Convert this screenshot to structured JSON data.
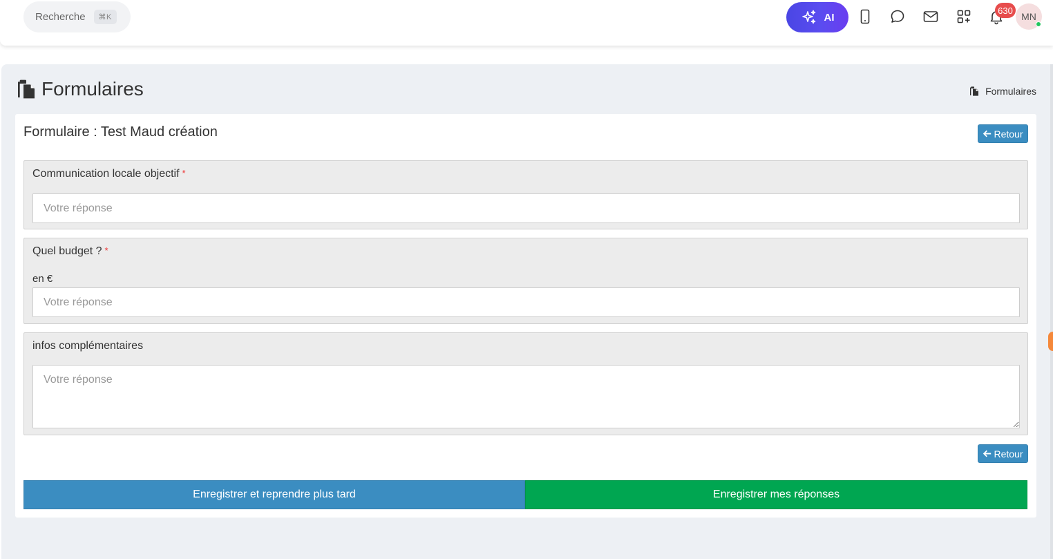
{
  "topbar": {
    "search_label": "Recherche",
    "search_shortcut": "⌘K",
    "ai_label": "AI",
    "notification_count": "630",
    "avatar_initials": "MN",
    "accent_gradient": [
      "#4a46e4",
      "#6a3df0"
    ]
  },
  "page": {
    "title": "Formulaires",
    "breadcrumb": "Formulaires"
  },
  "form": {
    "title": "Formulaire : Test Maud création",
    "back_label": "Retour",
    "questions": [
      {
        "label": "Communication locale objectif",
        "required": "*",
        "placeholder": "Votre réponse"
      },
      {
        "label": "Quel budget ?",
        "required": "*",
        "help": "en €",
        "placeholder": "Votre réponse"
      },
      {
        "label": "infos complémentaires",
        "placeholder": "Votre réponse"
      }
    ],
    "save_later_label": "Enregistrer et reprendre plus tard",
    "submit_label": "Enregistrer mes réponses"
  },
  "colors": {
    "primary": "#3b8dc1",
    "success": "#00a651",
    "required": "#e33333",
    "badge": "#e74c4c"
  },
  "icons": [
    "search-icon",
    "sparkles-icon",
    "mobile-icon",
    "chat-icon",
    "mail-icon",
    "apps-add-icon",
    "bell-icon",
    "clipboard-icon",
    "arrow-left-icon"
  ]
}
